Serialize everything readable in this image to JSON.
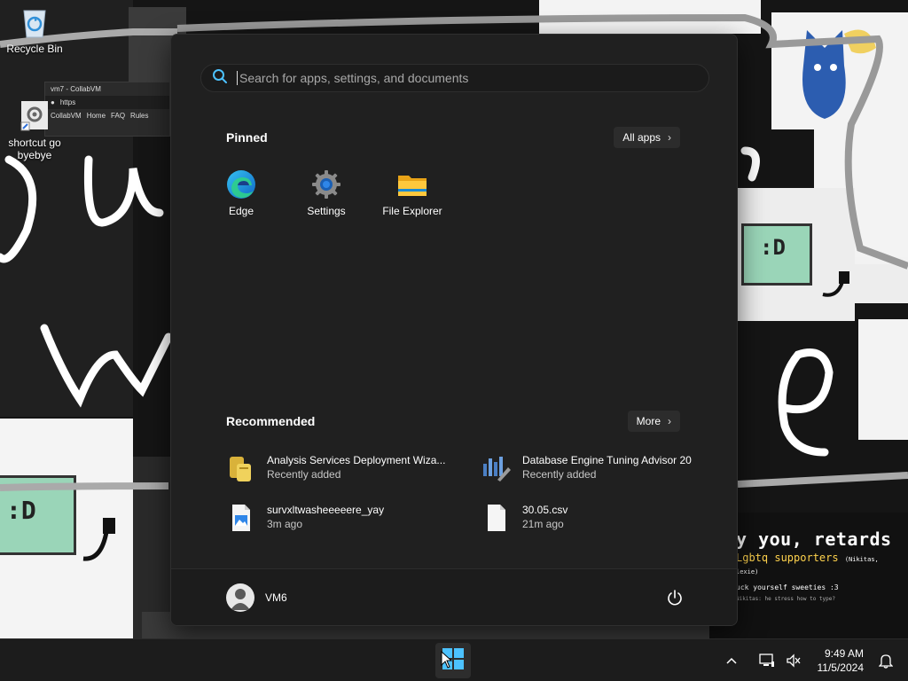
{
  "desktop": {
    "icons": [
      {
        "label": "Recycle Bin",
        "icon": "recycle-bin-icon"
      },
      {
        "label": "shortcut go byebye",
        "icon": "gear-shortcut-icon"
      }
    ],
    "browser_fragment": {
      "tab": "vm7 - CollabVM",
      "url_prefix": "https",
      "site": "CollabVM",
      "nav": [
        "Home",
        "FAQ",
        "Rules"
      ]
    },
    "wallpaper_text": {
      "headline": "y you, retards",
      "subline": "Lgbtq supporters",
      "subline_note": "(Nikitas, lexie)",
      "line3": "uck yourself sweeties :3",
      "small_text": "Nikitas: he stress how to type?"
    }
  },
  "start_menu": {
    "search": {
      "placeholder": "Search for apps, settings, and documents"
    },
    "pinned": {
      "title": "Pinned",
      "all_apps_label": "All apps",
      "apps": [
        {
          "label": "Edge",
          "icon": "edge-icon"
        },
        {
          "label": "Settings",
          "icon": "settings-gear-icon"
        },
        {
          "label": "File Explorer",
          "icon": "folder-icon"
        }
      ]
    },
    "recommended": {
      "title": "Recommended",
      "more_label": "More",
      "items": [
        {
          "name": "Analysis Services Deployment Wiza...",
          "sub": "Recently added",
          "icon": "deployment-wizard-icon"
        },
        {
          "name": "Database Engine Tuning Advisor 20",
          "sub": "Recently added",
          "icon": "tuning-advisor-icon"
        },
        {
          "name": "survxltwasheeeeere_yay",
          "sub": "3m ago",
          "icon": "image-file-icon"
        },
        {
          "name": "30.05.csv",
          "sub": "21m ago",
          "icon": "blank-file-icon"
        }
      ]
    },
    "user": {
      "name": "VM6"
    }
  },
  "taskbar": {
    "time": "9:49 AM",
    "date": "11/5/2024"
  },
  "colors": {
    "menu_bg": "#202020",
    "accent_blue": "#0078d4",
    "taskbar_bg": "#1c1c1c"
  }
}
